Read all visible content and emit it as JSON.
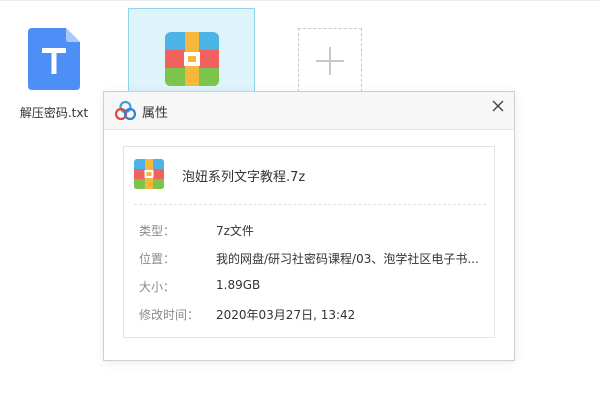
{
  "files": [
    {
      "name": "解压密码.txt",
      "icon": "text-file-icon",
      "icon_letter": "T"
    },
    {
      "name": "泡妞系列文字教程.7z",
      "icon": "archive-icon",
      "selected": true
    }
  ],
  "add_tile": {
    "icon": "plus-icon"
  },
  "dialog": {
    "title": "属性",
    "logo_icon": "cloud-logo-icon",
    "close_icon": "close-icon",
    "file_name": "泡妞系列文字教程.7z",
    "properties": {
      "type": {
        "label": "类型：",
        "value": "7z文件"
      },
      "location": {
        "label": "位置：",
        "value": "我的网盘/研习社密码课程/03、泡学社区电子书..."
      },
      "size": {
        "label": "大小：",
        "value": "1.89GB"
      },
      "modified": {
        "label": "修改时间：",
        "value": "2020年03月27日, 13:42"
      }
    }
  },
  "colors": {
    "txt_icon_blue": "#4d8ff7",
    "selection_bg": "#dff3fb",
    "selection_border": "#8fd3ec",
    "archive_yellow": "#f6b73a",
    "archive_red": "#f0625d",
    "archive_green": "#7cc44c",
    "archive_blue": "#4bb3e6"
  }
}
